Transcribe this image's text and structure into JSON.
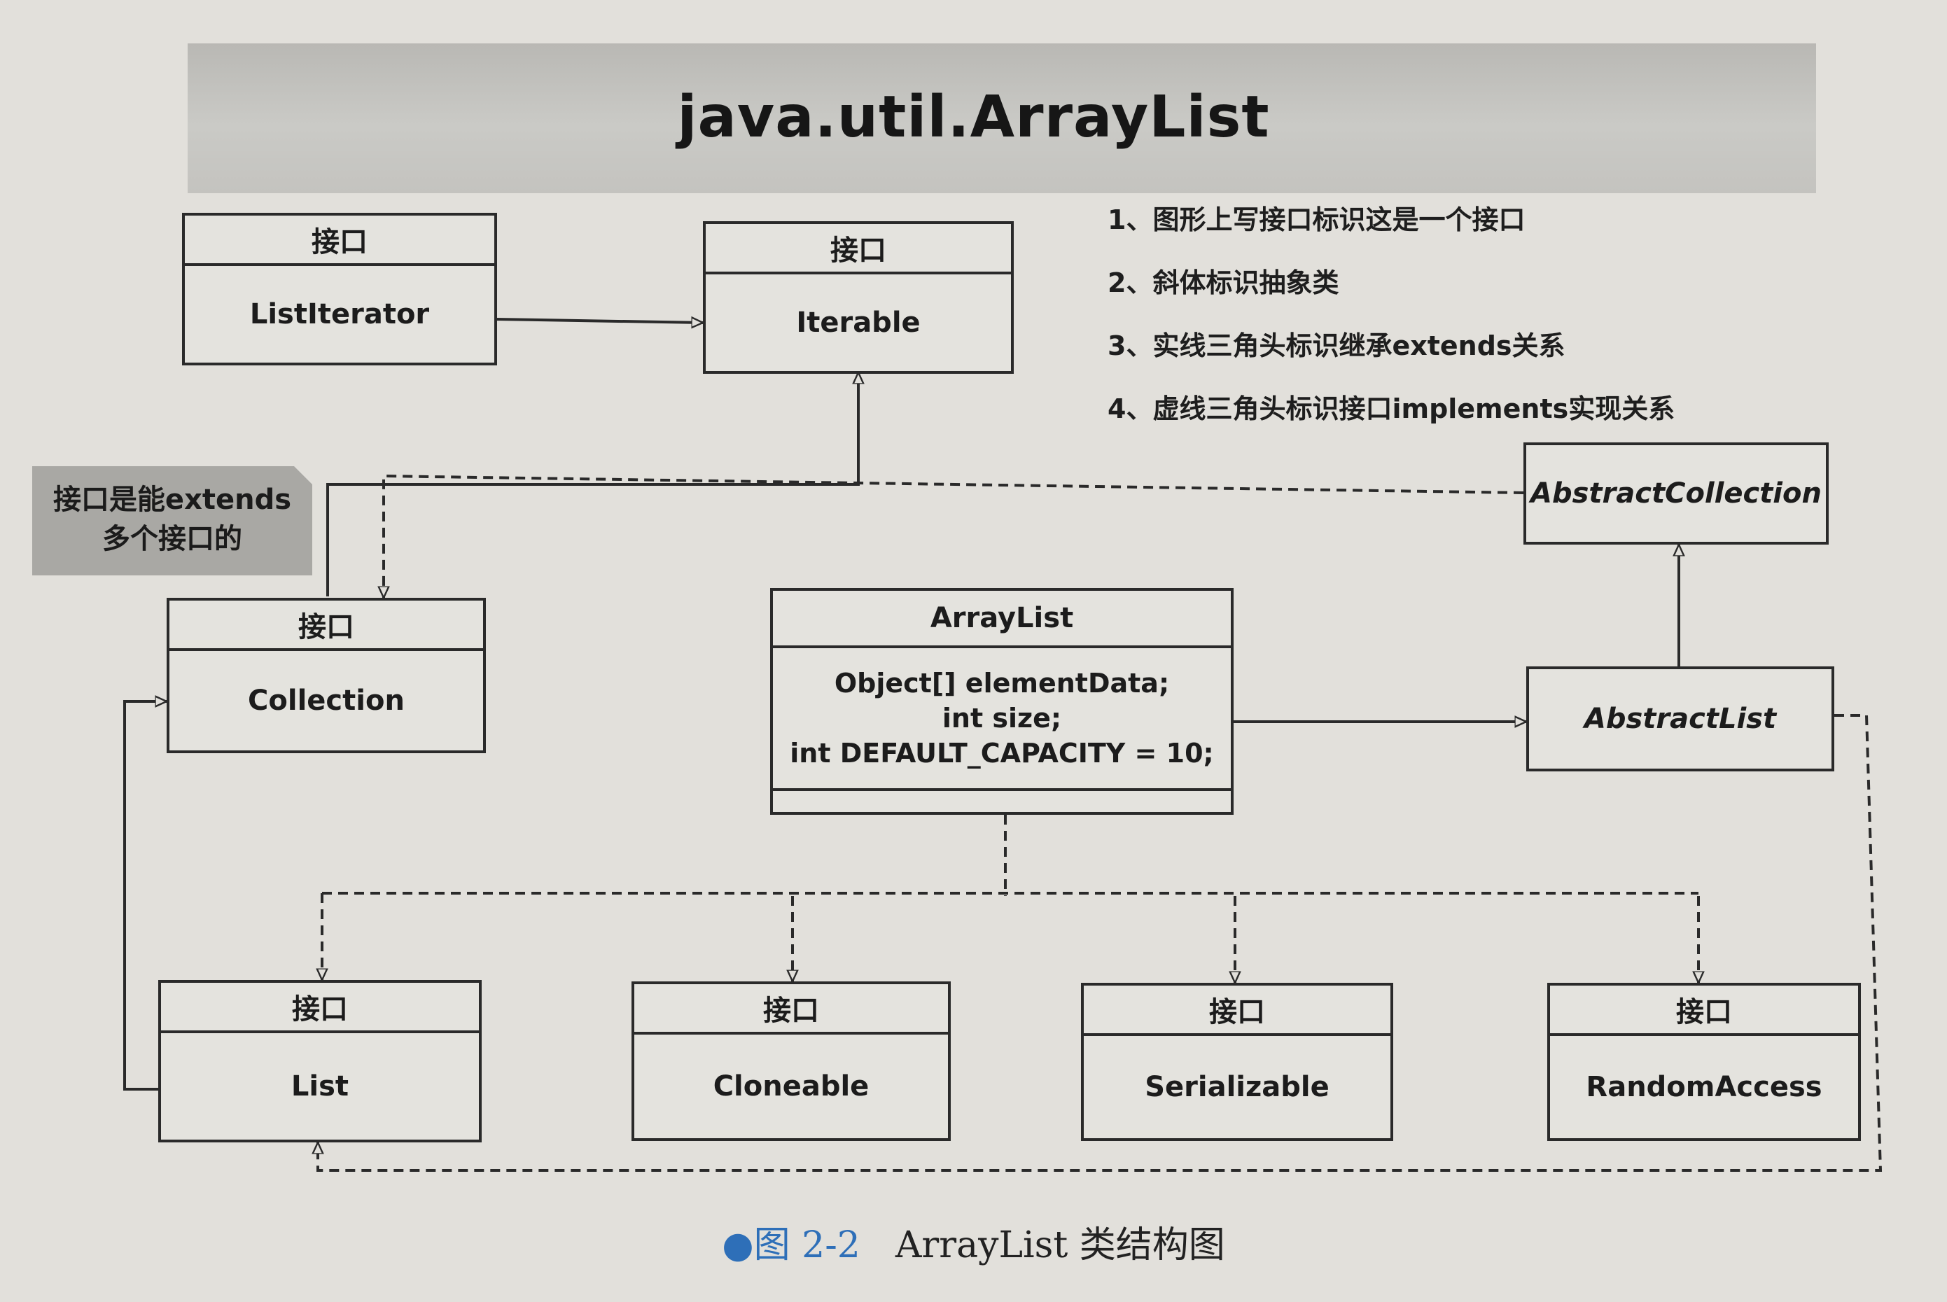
{
  "title": "java.util.ArrayList",
  "legend": [
    "1、图形上写接口标识这是一个接口",
    "2、斜体标识抽象类",
    "3、实线三角头标识继承extends关系",
    "4、虚线三角头标识接口implements实现关系"
  ],
  "note": {
    "line1": "接口是能extends",
    "line2": "多个接口的"
  },
  "interface_tag": "接口",
  "boxes": {
    "listiterator": "ListIterator",
    "iterable": "Iterable",
    "collection": "Collection",
    "list": "List",
    "cloneable": "Cloneable",
    "serializable": "Serializable",
    "randomaccess": "RandomAccess",
    "abstractcollection": "AbstractCollection",
    "abstractlist": "AbstractList",
    "arraylist": {
      "name": "ArrayList",
      "fields": [
        "Object[] elementData;",
        "int size;",
        "int DEFAULT_CAPACITY = 10;"
      ]
    }
  },
  "caption": {
    "label": "图 2-2",
    "text": "ArrayList 类结构图"
  },
  "colors": {
    "background": "#e2e0db",
    "title_band": "#c4c3bf",
    "note_bg": "#a9a8a4",
    "line": "#2a2a2a",
    "caption_accent": "#2e6fb8"
  }
}
